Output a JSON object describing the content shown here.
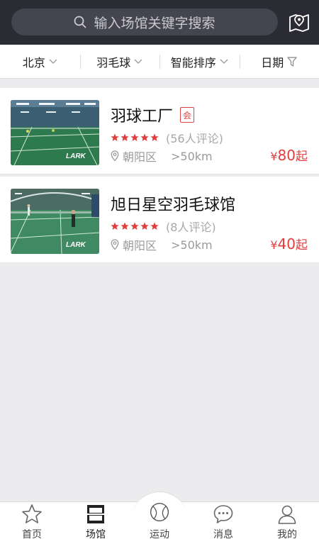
{
  "search": {
    "placeholder": "输入场馆关键字搜索"
  },
  "filters": [
    {
      "label": "北京"
    },
    {
      "label": "羽毛球"
    },
    {
      "label": "智能排序"
    },
    {
      "label": "日期"
    }
  ],
  "venues": [
    {
      "name": "羽球工厂",
      "badge": "会",
      "rating": 5,
      "reviews": "(56人评论)",
      "district": "朝阳区",
      "distance": ">50km",
      "price_symbol": "¥",
      "price": "80",
      "price_suffix": "起",
      "thumb_label": "LARK"
    },
    {
      "name": "旭日星空羽毛球馆",
      "rating": 5,
      "reviews": "(8人评论)",
      "district": "朝阳区",
      "distance": ">50km",
      "price_symbol": "¥",
      "price": "40",
      "price_suffix": "起",
      "thumb_label": "LARK"
    }
  ],
  "nav": [
    {
      "label": "首页",
      "icon": "star-icon"
    },
    {
      "label": "场馆",
      "icon": "venue-icon"
    },
    {
      "label": "运动",
      "icon": "ball-icon"
    },
    {
      "label": "消息",
      "icon": "chat-icon"
    },
    {
      "label": "我的",
      "icon": "person-icon"
    }
  ],
  "colors": {
    "header": "#2b2b33",
    "accent": "#e23d3d",
    "star": "#e23d3d"
  }
}
